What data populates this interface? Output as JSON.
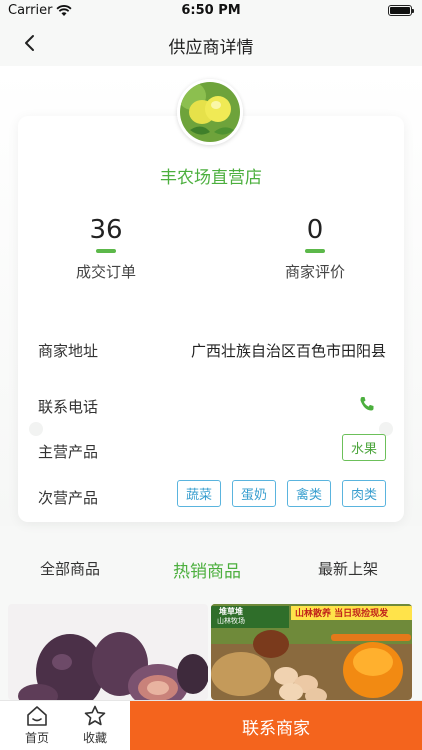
{
  "status": {
    "carrier": "Carrier",
    "time": "6:50 PM",
    "battery_level": 1.0
  },
  "nav": {
    "title": "供应商详情",
    "back_icon": "chevron-left-icon"
  },
  "store": {
    "name": "丰农场直营店",
    "avatar_icon": "lemon-avatar",
    "stats": [
      {
        "value": "36",
        "label": "成交订单"
      },
      {
        "value": "0",
        "label": "商家评价"
      }
    ]
  },
  "info": {
    "address_label": "商家地址",
    "address_value": "广西壮族自治区百色市田阳县",
    "phone_label": "联系电话",
    "phone_icon": "phone-icon",
    "main_label": "主营产品",
    "main_tags": [
      "水果"
    ],
    "secondary_label": "次营产品",
    "secondary_tags": [
      "蔬菜",
      "蛋奶",
      "禽类",
      "肉类"
    ]
  },
  "tabs": [
    {
      "label": "全部商品",
      "active": false
    },
    {
      "label": "热销商品",
      "active": true
    },
    {
      "label": "最新上架",
      "active": false
    }
  ],
  "products": [
    {
      "image": "figs-photo"
    },
    {
      "image": "eggs-photo",
      "banner_left": "堆草堆",
      "banner_left_sub": "山林牧场",
      "banner_right": "山林散养 当日现捡现发"
    }
  ],
  "bottom": {
    "home_label": "首页",
    "favorite_label": "收藏",
    "contact_label": "联系商家"
  },
  "colors": {
    "accent_green": "#4caf3e",
    "tag_blue": "#3a9fcf",
    "cta_orange": "#f4641d"
  }
}
